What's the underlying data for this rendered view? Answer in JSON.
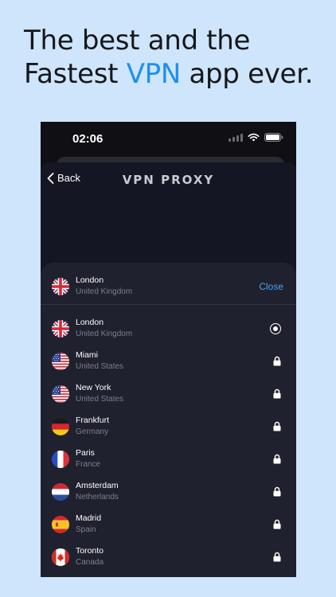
{
  "promo": {
    "line1": "The best and the",
    "line2_pre": "Fastest ",
    "line2_highlight": "VPN",
    "line2_post": " app ever."
  },
  "status_bar": {
    "time": "02:06"
  },
  "nav": {
    "back_label": "Back",
    "title": "VPN PROXY"
  },
  "selected": {
    "city": "London",
    "country": "United Kingdom",
    "close_label": "Close",
    "flag": "uk-flag-icon"
  },
  "locations": [
    {
      "city": "London",
      "country": "United Kingdom",
      "flag": "uk-flag-icon",
      "status": "selected"
    },
    {
      "city": "Miami",
      "country": "United States",
      "flag": "us-flag-icon",
      "status": "locked"
    },
    {
      "city": "New York",
      "country": "United States",
      "flag": "us-flag-icon",
      "status": "locked"
    },
    {
      "city": "Frankfurt",
      "country": "Germany",
      "flag": "germany-flag-icon",
      "status": "locked"
    },
    {
      "city": "Paris",
      "country": "France",
      "flag": "france-flag-icon",
      "status": "locked"
    },
    {
      "city": "Amsterdam",
      "country": "Netherlands",
      "flag": "netherlands-flag-icon",
      "status": "locked"
    },
    {
      "city": "Madrid",
      "country": "Spain",
      "flag": "spain-flag-icon",
      "status": "locked"
    },
    {
      "city": "Toronto",
      "country": "Canada",
      "flag": "canada-flag-icon",
      "status": "locked"
    }
  ],
  "colors": {
    "background": "#cfe5fb",
    "accent": "#1d8ff0",
    "panel": "#20212e",
    "close": "#4aa3f0"
  }
}
